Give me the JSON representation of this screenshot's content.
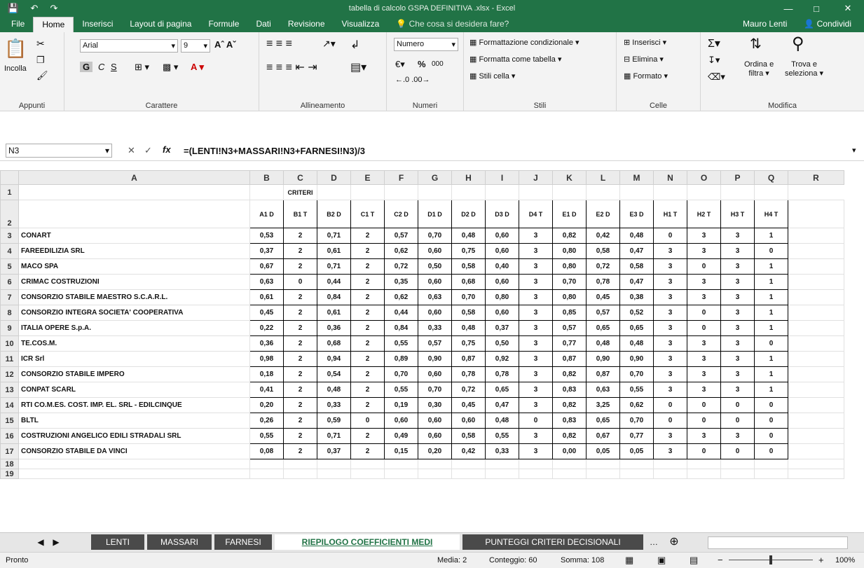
{
  "window": {
    "title": "tabella di calcolo GSPA DEFINITIVA .xlsx - Excel"
  },
  "tabs": [
    "File",
    "Home",
    "Inserisci",
    "Layout di pagina",
    "Formule",
    "Dati",
    "Revisione",
    "Visualizza"
  ],
  "active_tab": "Home",
  "tell_me": "Che cosa si desidera fare?",
  "user": "Mauro Lenti",
  "share": "Condividi",
  "ribbon": {
    "appunti": {
      "label": "Appunti",
      "paste": "Incolla"
    },
    "carattere": {
      "label": "Carattere",
      "font": "Arial",
      "size": "9",
      "bold": "G",
      "italic": "C",
      "underline": "S"
    },
    "allineamento": {
      "label": "Allineamento"
    },
    "numeri": {
      "label": "Numeri",
      "format": "Numero",
      "percent": "%",
      "thousands": "000"
    },
    "stili": {
      "label": "Stili",
      "cond": "Formattazione condizionale",
      "table": "Formatta come tabella",
      "cell": "Stili cella"
    },
    "celle": {
      "label": "Celle",
      "insert": "Inserisci",
      "delete": "Elimina",
      "format": "Formato"
    },
    "modifica": {
      "label": "Modifica",
      "sort": "Ordina e",
      "sort2": "filtra",
      "find": "Trova e",
      "find2": "seleziona"
    }
  },
  "formula_bar": {
    "cell_ref": "N3",
    "formula": "=(LENTI!N3+MASSARI!N3+FARNESI!N3)/3"
  },
  "columns": [
    "A",
    "B",
    "C",
    "D",
    "E",
    "F",
    "G",
    "H",
    "I",
    "J",
    "K",
    "L",
    "M",
    "N",
    "O",
    "P",
    "Q",
    "R"
  ],
  "criteri_label": "CRITERI",
  "headers": [
    "A1 D",
    "B1 T",
    "B2 D",
    "C1 T",
    "C2 D",
    "D1 D",
    "D2 D",
    "D3 D",
    "D4 T",
    "E1 D",
    "E2 D",
    "E3 D",
    "H1 T",
    "H2 T",
    "H3 T",
    "H4 T"
  ],
  "rows": [
    {
      "n": "3",
      "name": "CONART",
      "v": [
        "0,53",
        "2",
        "0,71",
        "2",
        "0,57",
        "0,70",
        "0,48",
        "0,60",
        "3",
        "0,82",
        "0,42",
        "0,48",
        "0",
        "3",
        "3",
        "1"
      ]
    },
    {
      "n": "4",
      "name": "FAREEDILIZIA SRL",
      "v": [
        "0,37",
        "2",
        "0,61",
        "2",
        "0,62",
        "0,60",
        "0,75",
        "0,60",
        "3",
        "0,80",
        "0,58",
        "0,47",
        "3",
        "3",
        "3",
        "0"
      ]
    },
    {
      "n": "5",
      "name": "MACO SPA",
      "v": [
        "0,67",
        "2",
        "0,71",
        "2",
        "0,72",
        "0,50",
        "0,58",
        "0,40",
        "3",
        "0,80",
        "0,72",
        "0,58",
        "3",
        "0",
        "3",
        "1"
      ]
    },
    {
      "n": "6",
      "name": "CRIMAC COSTRUZIONI",
      "v": [
        "0,63",
        "0",
        "0,44",
        "2",
        "0,35",
        "0,60",
        "0,68",
        "0,60",
        "3",
        "0,70",
        "0,78",
        "0,47",
        "3",
        "3",
        "3",
        "1"
      ]
    },
    {
      "n": "7",
      "name": "CONSORZIO STABILE MAESTRO S.C.A.R.L.",
      "v": [
        "0,61",
        "2",
        "0,84",
        "2",
        "0,62",
        "0,63",
        "0,70",
        "0,80",
        "3",
        "0,80",
        "0,45",
        "0,38",
        "3",
        "3",
        "3",
        "1"
      ]
    },
    {
      "n": "8",
      "name": "CONSORZIO INTEGRA SOCIETA' COOPERATIVA",
      "v": [
        "0,45",
        "2",
        "0,61",
        "2",
        "0,44",
        "0,60",
        "0,58",
        "0,60",
        "3",
        "0,85",
        "0,57",
        "0,52",
        "3",
        "0",
        "3",
        "1"
      ]
    },
    {
      "n": "9",
      "name": "ITALIA OPERE S.p.A.",
      "v": [
        "0,22",
        "2",
        "0,36",
        "2",
        "0,84",
        "0,33",
        "0,48",
        "0,37",
        "3",
        "0,57",
        "0,65",
        "0,65",
        "3",
        "0",
        "3",
        "1"
      ]
    },
    {
      "n": "10",
      "name": "TE.COS.M.",
      "v": [
        "0,36",
        "2",
        "0,68",
        "2",
        "0,55",
        "0,57",
        "0,75",
        "0,50",
        "3",
        "0,77",
        "0,48",
        "0,48",
        "3",
        "3",
        "3",
        "0"
      ]
    },
    {
      "n": "11",
      "name": "ICR Srl",
      "v": [
        "0,98",
        "2",
        "0,94",
        "2",
        "0,89",
        "0,90",
        "0,87",
        "0,92",
        "3",
        "0,87",
        "0,90",
        "0,90",
        "3",
        "3",
        "3",
        "1"
      ]
    },
    {
      "n": "12",
      "name": "CONSORZIO STABILE IMPERO",
      "v": [
        "0,18",
        "2",
        "0,54",
        "2",
        "0,70",
        "0,60",
        "0,78",
        "0,78",
        "3",
        "0,82",
        "0,87",
        "0,70",
        "3",
        "3",
        "3",
        "1"
      ]
    },
    {
      "n": "13",
      "name": "CONPAT SCARL",
      "v": [
        "0,41",
        "2",
        "0,48",
        "2",
        "0,55",
        "0,70",
        "0,72",
        "0,65",
        "3",
        "0,83",
        "0,63",
        "0,55",
        "3",
        "3",
        "3",
        "1"
      ]
    },
    {
      "n": "14",
      "name": "RTI CO.M.ES. COST. IMP. EL. SRL - EDILCINQUE",
      "v": [
        "0,20",
        "2",
        "0,33",
        "2",
        "0,19",
        "0,30",
        "0,45",
        "0,47",
        "3",
        "0,82",
        "3,25",
        "0,62",
        "0",
        "0",
        "0",
        "0"
      ]
    },
    {
      "n": "15",
      "name": "BLTL",
      "v": [
        "0,26",
        "2",
        "0,59",
        "0",
        "0,60",
        "0,60",
        "0,60",
        "0,48",
        "0",
        "0,83",
        "0,65",
        "0,70",
        "0",
        "0",
        "0",
        "0"
      ]
    },
    {
      "n": "16",
      "name": "COSTRUZIONI ANGELICO EDILI STRADALI SRL",
      "v": [
        "0,55",
        "2",
        "0,71",
        "2",
        "0,49",
        "0,60",
        "0,58",
        "0,55",
        "3",
        "0,82",
        "0,67",
        "0,77",
        "3",
        "3",
        "3",
        "0"
      ]
    },
    {
      "n": "17",
      "name": "CONSORZIO STABILE DA VINCI",
      "v": [
        "0,08",
        "2",
        "0,37",
        "2",
        "0,15",
        "0,20",
        "0,42",
        "0,33",
        "3",
        "0,00",
        "0,05",
        "0,05",
        "3",
        "0",
        "0",
        "0"
      ]
    }
  ],
  "sheets": [
    "LENTI",
    "MASSARI",
    "FARNESI",
    "RIEPILOGO COEFFICIENTI MEDI",
    "PUNTEGGI CRITERI DECISIONALI"
  ],
  "active_sheet": "RIEPILOGO COEFFICIENTI MEDI",
  "status": {
    "ready": "Pronto",
    "avg": "Media: 2",
    "count": "Conteggio: 60",
    "sum": "Somma: 108",
    "zoom": "100%"
  }
}
